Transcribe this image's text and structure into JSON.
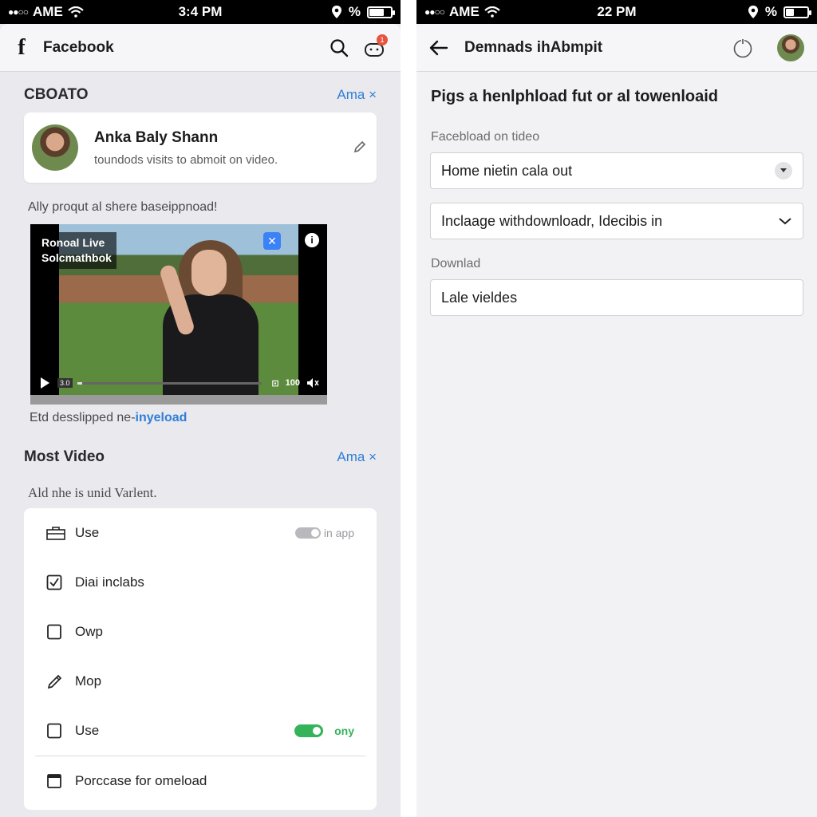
{
  "left": {
    "status_bar": {
      "carrier": "AME",
      "time": "3:4 PM",
      "percent": "%",
      "battery_level": 0.7
    },
    "app_bar": {
      "title": "Facebook",
      "notification_count": "1"
    },
    "section1": {
      "title": "CBOATO",
      "action": "Ama ×"
    },
    "profile": {
      "name": "Anka Baly Shann",
      "subtitle": "toundods visits to abmoit on video."
    },
    "caption": "Ally proqut al shere baseippnoad!",
    "video": {
      "label_line1": "Ronoal Live",
      "label_line2": "Solcmathbok",
      "time": "3.0",
      "volume": "100",
      "progress": 0.03
    },
    "download_status": {
      "text": "Etd desslipped ",
      "prefix2": "ne-",
      "link": "inyeload"
    },
    "section2": {
      "title": "Most Video",
      "action": "Ama ×"
    },
    "description": "Ald nhe is unid Varlent.",
    "list": [
      {
        "label": "Use",
        "icon": "briefcase-icon",
        "toggle_text": "in app",
        "toggle_on": false
      },
      {
        "label": "Diai inclabs",
        "icon": "checkbox-checked-icon"
      },
      {
        "label": "Owp",
        "icon": "checkbox-icon"
      },
      {
        "label": "Mop",
        "icon": "pen-icon"
      },
      {
        "label": "Use",
        "icon": "checkbox-icon",
        "toggle_text": "ony",
        "toggle_on": true
      },
      {
        "label": "Porccase for omeload",
        "icon": "calendar-icon"
      }
    ],
    "colors": {
      "accent": "#2f7fd6",
      "toggle_on": "#34b35a",
      "toggle_off": "#b8b8bd",
      "badge": "#e8533f"
    }
  },
  "right": {
    "status_bar": {
      "carrier": "AME",
      "time": "22 PM",
      "percent": "%",
      "battery_level": 0.4
    },
    "app_bar": {
      "title": "Demnads ihAbmpit"
    },
    "heading": "Pigs a henlphload fut or al towenloaid",
    "field1": {
      "label": "Facebload on tideo",
      "value": "Home nietin cala out"
    },
    "field2": {
      "value": "Inclaage withdownloadr, Idecibis in"
    },
    "field3": {
      "label": "Downlad",
      "value": "Lale vieldes"
    }
  }
}
